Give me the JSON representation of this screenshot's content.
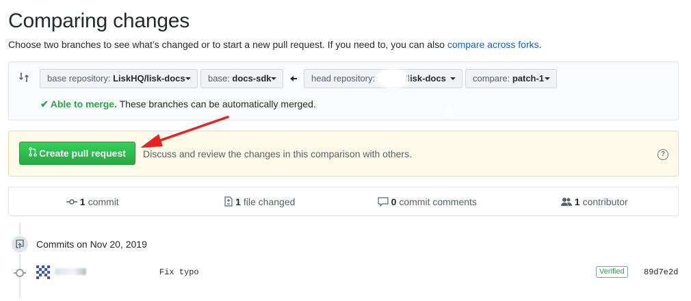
{
  "page": {
    "title": "Comparing changes",
    "subtitle_prefix": "Choose two branches to see what’s changed or to start a new pull request. If you need to, you can also ",
    "subtitle_link": "compare across forks",
    "subtitle_suffix": "."
  },
  "range": {
    "base_repo_label": "base repository: ",
    "base_repo_value": "LiskHQ/lisk-docs",
    "base_label": "base: ",
    "base_value": "docs-sdk",
    "head_repo_label": "head repository: ",
    "head_repo_value": "/lisk-docs",
    "compare_label": "compare: ",
    "compare_value": "patch-1",
    "merge_check": "✔",
    "merge_ok": "Able to merge.",
    "merge_text": " These branches can be automatically merged."
  },
  "pull_request": {
    "button_label": "Create pull request",
    "description": "Discuss and review the changes in this comparison with others.",
    "help": "?"
  },
  "stats": {
    "commits_num": "1",
    "commits_label": "commit",
    "files_num": "1",
    "files_label": "file changed",
    "comments_num": "0",
    "comments_label": "commit comments",
    "contributors_num": "1",
    "contributors_label": "contributor"
  },
  "timeline": {
    "date_heading": "Commits on Nov 20, 2019",
    "commit_message": "Fix typo",
    "verified_label": "Verified",
    "sha": "89d7e2d"
  },
  "colors": {
    "accent_green": "#28a745",
    "link_blue": "#0366d6",
    "annotation_red": "#e8231f"
  },
  "icons": [
    "compare-icon",
    "caret-down-icon",
    "arrow-left-icon",
    "check-icon",
    "pull-request-icon",
    "question-icon",
    "commit-icon",
    "file-diff-icon",
    "comment-icon",
    "people-icon",
    "repo-push-icon"
  ]
}
